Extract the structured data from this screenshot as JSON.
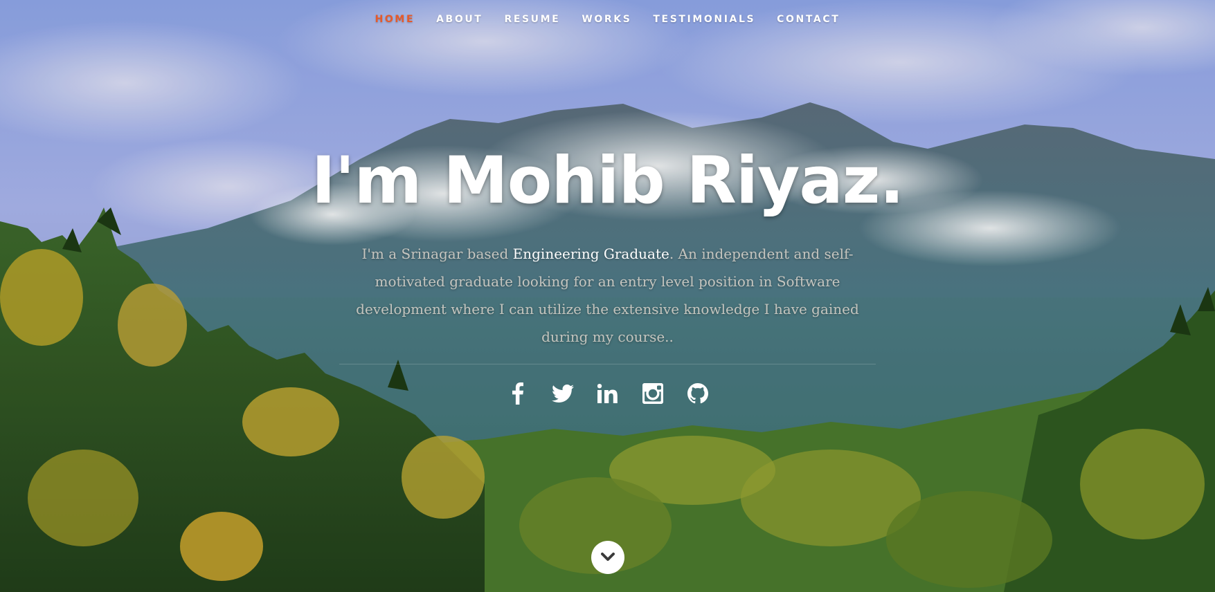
{
  "nav": {
    "items": [
      {
        "label": "HOME",
        "active": true
      },
      {
        "label": "ABOUT",
        "active": false
      },
      {
        "label": "RESUME",
        "active": false
      },
      {
        "label": "WORKS",
        "active": false
      },
      {
        "label": "TESTIMONIALS",
        "active": false
      },
      {
        "label": "CONTACT",
        "active": false
      }
    ],
    "active_color": "#e55a2b"
  },
  "hero": {
    "title": "I'm Mohib Riyaz.",
    "desc_before": "I'm a Srinagar based ",
    "desc_highlight": "Engineering Graduate",
    "desc_after": ". An independent and self-motivated graduate looking for an entry level position in Software development where I can utilize the extensive knowledge I have gained during my course.."
  },
  "social": [
    {
      "icon": "facebook-icon"
    },
    {
      "icon": "twitter-icon"
    },
    {
      "icon": "linkedin-icon"
    },
    {
      "icon": "instagram-icon"
    },
    {
      "icon": "github-icon"
    }
  ],
  "scroll": {
    "icon": "chevron-down-icon"
  }
}
